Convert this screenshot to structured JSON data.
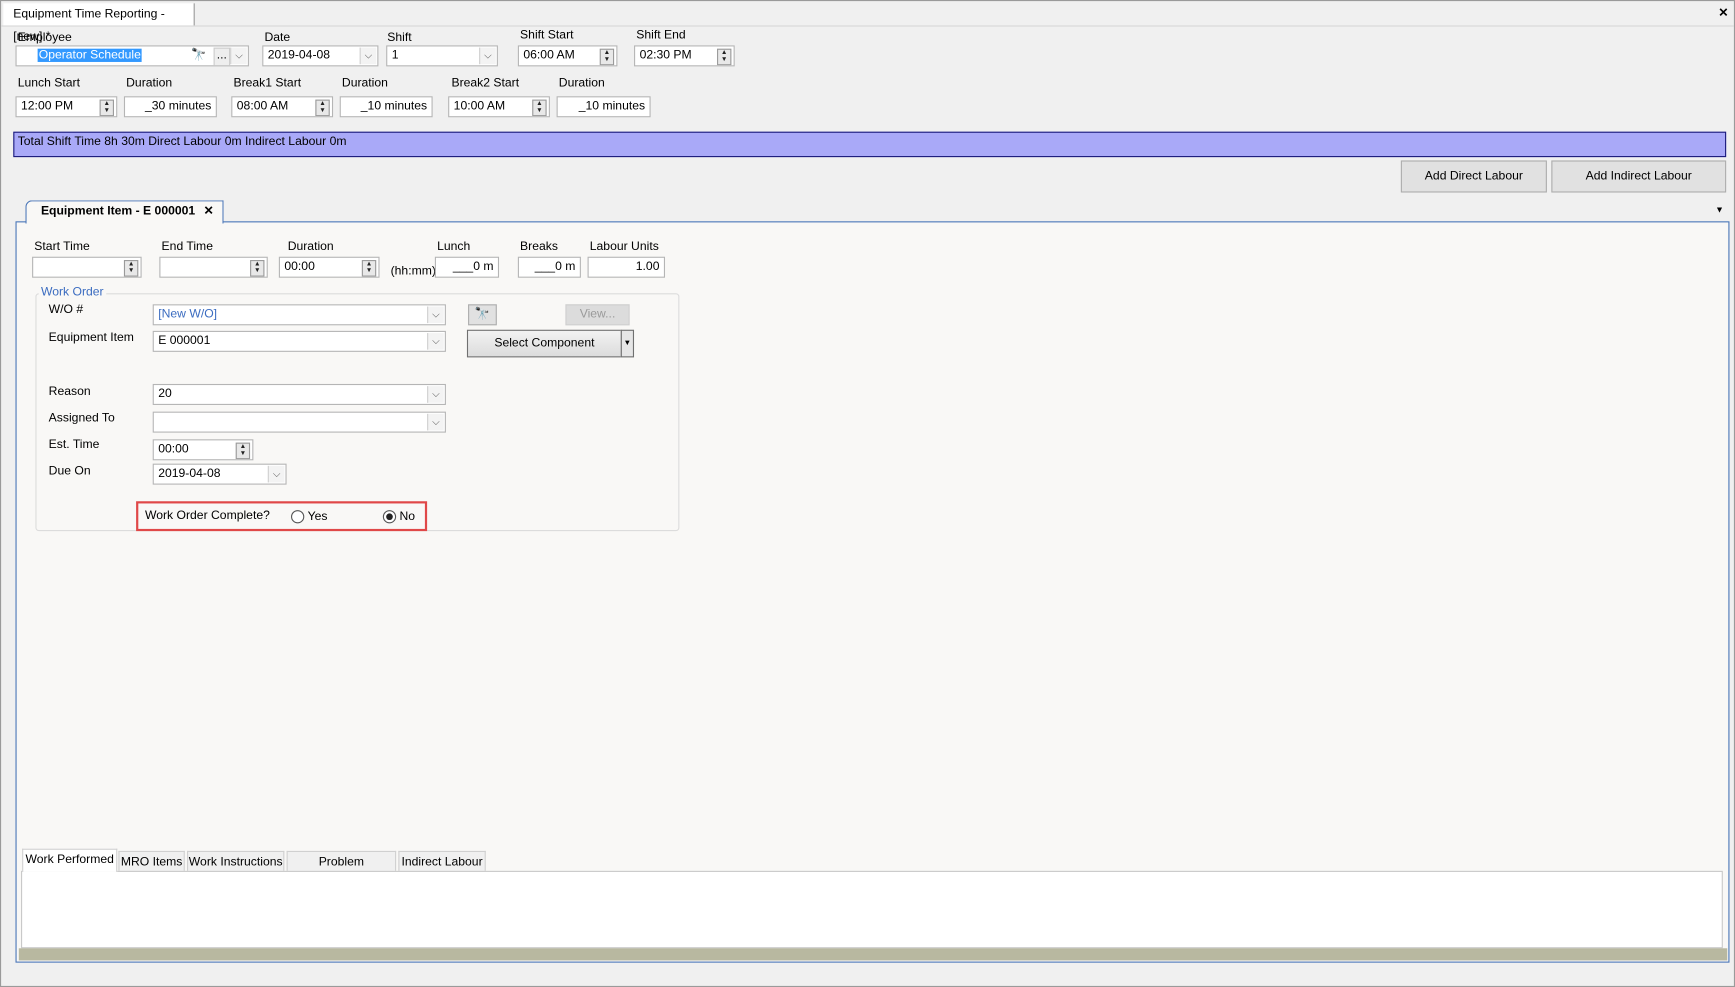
{
  "window": {
    "title": "Equipment Time Reporting - [new] *",
    "close": "✕"
  },
  "header": {
    "employee": {
      "label": "Employee",
      "value": "Operator Schedule",
      "more": "..."
    },
    "date": {
      "label": "Date",
      "value": "2019-04-08"
    },
    "shift": {
      "label": "Shift",
      "value": "1"
    },
    "shift_start": {
      "label": "Shift Start",
      "value": "06:00 AM"
    },
    "shift_end": {
      "label": "Shift End",
      "value": "02:30 PM"
    },
    "lunch_start": {
      "label": "Lunch Start",
      "value": "12:00 PM"
    },
    "lunch_duration": {
      "label": "Duration",
      "value": "_30 minutes"
    },
    "break1_start": {
      "label": "Break1 Start",
      "value": "08:00 AM"
    },
    "break1_duration": {
      "label": "Duration",
      "value": "_10 minutes"
    },
    "break2_start": {
      "label": "Break2 Start",
      "value": "10:00 AM"
    },
    "break2_duration": {
      "label": "Duration",
      "value": "_10 minutes"
    }
  },
  "summary": "Total Shift Time 8h 30m  Direct Labour 0m  Indirect Labour 0m",
  "actions": {
    "add_direct": "Add Direct Labour",
    "add_indirect": "Add Indirect Labour"
  },
  "doc_tab": {
    "label": "Equipment Item - E 000001",
    "close": "✕"
  },
  "times": {
    "start_time": {
      "label": "Start Time",
      "value": ""
    },
    "end_time": {
      "label": "End Time",
      "value": ""
    },
    "duration": {
      "label": "Duration",
      "value": "00:00",
      "unit": "(hh:mm)"
    },
    "lunch": {
      "label": "Lunch",
      "value": "___0 m"
    },
    "breaks": {
      "label": "Breaks",
      "value": "___0 m"
    },
    "labour_units": {
      "label": "Labour Units",
      "value": "1.00"
    }
  },
  "work_order": {
    "legend": "Work Order",
    "wo": {
      "label": "W/O #",
      "value": "[New W/O]"
    },
    "view": "View...",
    "equipment": {
      "label": "Equipment Item",
      "value": "E 000001"
    },
    "select_component": "Select Component",
    "reason": {
      "label": "Reason",
      "value": "20"
    },
    "assigned_to": {
      "label": "Assigned To",
      "value": ""
    },
    "est_time": {
      "label": "Est. Time",
      "value": "00:00"
    },
    "due_on": {
      "label": "Due On",
      "value": "2019-04-08"
    },
    "complete": {
      "label": "Work Order Complete?",
      "yes": "Yes",
      "no": "No",
      "selected": "No"
    }
  },
  "bottom_tabs": [
    {
      "label": "Work Performed",
      "active": true
    },
    {
      "label": "MRO Items"
    },
    {
      "label": "Work Instructions"
    },
    {
      "label": "Problem Description"
    },
    {
      "label": "Indirect Labour"
    }
  ],
  "colors": {
    "banner": "#a9a9f8",
    "highlight": "#e04848",
    "accent": "#3b6cc0"
  }
}
